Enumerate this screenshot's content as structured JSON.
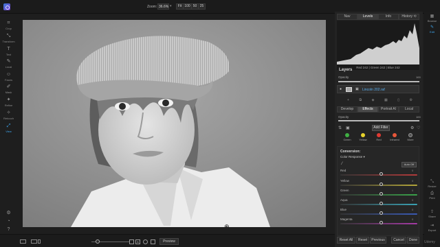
{
  "topbar": {
    "zoom_label": "Zoom:",
    "zoom_value": "36.6%",
    "zoom_buttons": [
      "Fit",
      "100",
      "50",
      "25"
    ]
  },
  "left_tools": [
    {
      "label": "Crop",
      "icon": "crop-icon"
    },
    {
      "label": "Transform",
      "icon": "transform-icon"
    },
    {
      "label": "Text",
      "icon": "text-icon"
    },
    {
      "label": "Local",
      "icon": "brush-icon"
    },
    {
      "label": "Faces",
      "icon": "faces-icon"
    },
    {
      "label": "Mask",
      "icon": "mask-icon"
    },
    {
      "label": "Refine",
      "icon": "refine-icon"
    },
    {
      "label": "Retouch",
      "icon": "retouch-icon"
    },
    {
      "label": "View",
      "icon": "view-icon",
      "active": true
    }
  ],
  "bottom": {
    "preview_label": "Preview",
    "size_box": "A"
  },
  "panel": {
    "top_tabs": [
      "Nav",
      "Levels",
      "Info",
      "History ⟲"
    ],
    "active_top_tab": 1,
    "histogram_readout": "Red 242 | Green 242 | Blue 242",
    "layers_title": "Layers",
    "opacity_label": "Opacity",
    "opacity_value": "100",
    "layer_opacity_fraction": 1.0,
    "layer_name": "Lincoln 202.raf",
    "module_tabs": [
      "Develop",
      "Effects",
      "Portrait AI",
      "Local"
    ],
    "active_module_tab": 1,
    "effects_opacity_label": "Opacity",
    "effects_opacity_value": "100",
    "add_filter_label": "Add Filter",
    "presets": [
      {
        "label": "Green",
        "color": "#3fb043"
      },
      {
        "label": "Yellow",
        "color": "#e8d32c"
      },
      {
        "label": "Red",
        "color": "#e03a32"
      },
      {
        "label": "Infrared",
        "color": "#e8573a"
      },
      {
        "label": "More",
        "color": "#555555"
      }
    ],
    "conversion_title": "Conversion:",
    "color_response": "Color Response",
    "auto_off_label": "Auto Off",
    "channels": [
      {
        "label": "Red",
        "value": "0",
        "color": "#b33a3a"
      },
      {
        "label": "Yellow",
        "value": "0",
        "color": "#b5a73a"
      },
      {
        "label": "Green",
        "value": "0",
        "color": "#3aa44a"
      },
      {
        "label": "Aqua",
        "value": "0",
        "color": "#3aa3b5"
      },
      {
        "label": "Blue",
        "value": "0",
        "color": "#3a5ab5"
      },
      {
        "label": "Magenta",
        "value": "0",
        "color": "#a53aa5"
      }
    ],
    "bottom_buttons": [
      "Reset All",
      "Reset",
      "Previous",
      "Cancel",
      "Done"
    ]
  },
  "right_strip": [
    {
      "label": "Browse",
      "icon": "browse-icon"
    },
    {
      "label": "Edit",
      "icon": "edit-icon",
      "active": true
    },
    {
      "label": "Resize",
      "icon": "resize-icon"
    },
    {
      "label": "Print",
      "icon": "print-icon"
    },
    {
      "label": "Share",
      "icon": "share-icon"
    },
    {
      "label": "Export",
      "icon": "export-icon"
    }
  ],
  "watermark": "Udemy",
  "accent_color": "#3fa7ef"
}
